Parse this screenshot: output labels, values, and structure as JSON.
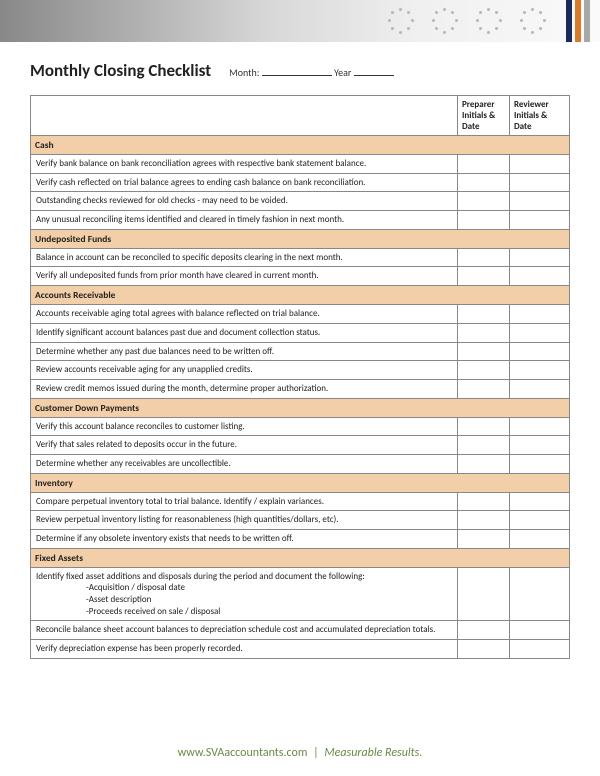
{
  "header": {
    "title": "Monthly Closing Checklist",
    "month_label": "Month:",
    "year_label": "Year"
  },
  "columns": {
    "preparer": "Preparer Initials & Date",
    "reviewer": "Reviewer Initials & Date"
  },
  "sections": [
    {
      "name": "Cash",
      "items": [
        "Verify bank balance on bank reconciliation agrees with respective bank statement balance.",
        "Verify cash reflected on trial balance agrees to ending cash balance on bank reconciliation.",
        "Outstanding checks reviewed for old checks - may need to be voided.",
        "Any unusual reconciling items identified and cleared in timely fashion in next month."
      ]
    },
    {
      "name": "Undeposited Funds",
      "items": [
        "Balance in account can be reconciled to specific deposits clearing in the next month.",
        "Verify all undeposited funds from prior month have cleared in current month."
      ]
    },
    {
      "name": "Accounts Receivable",
      "items": [
        "Accounts receivable aging total agrees with balance reflected on trial balance.",
        "Identify significant account balances past due and document collection status.",
        "Determine whether any past due balances need to be written off.",
        "Review accounts receivable aging for any unapplied credits.",
        "Review credit memos issued during the month, determine proper authorization."
      ]
    },
    {
      "name": "Customer Down Payments",
      "items": [
        "Verify this account balance reconciles to customer listing.",
        "Verify that sales related to deposits occur in the future.",
        "Determine whether any receivables are uncollectible."
      ]
    },
    {
      "name": "Inventory",
      "items": [
        "Compare perpetual inventory total to trial balance.  Identify / explain variances.",
        "Review perpetual inventory listing for reasonableness (high quantities/dollars, etc).",
        "Determine if any obsolete inventory exists that needs to be written off."
      ]
    },
    {
      "name": "Fixed Assets",
      "items": [
        "Identify fixed asset additions and disposals during the period and document the following:\n-Acquisition / disposal date\n-Asset description\n-Proceeds received on sale / disposal",
        "Reconcile balance sheet account balances to depreciation schedule cost and accumulated depreciation totals.",
        "Verify depreciation expense has been properly recorded."
      ]
    }
  ],
  "footer": {
    "site": "www.SVAaccountants.com",
    "divider": "|",
    "tagline": "Measurable Results."
  }
}
